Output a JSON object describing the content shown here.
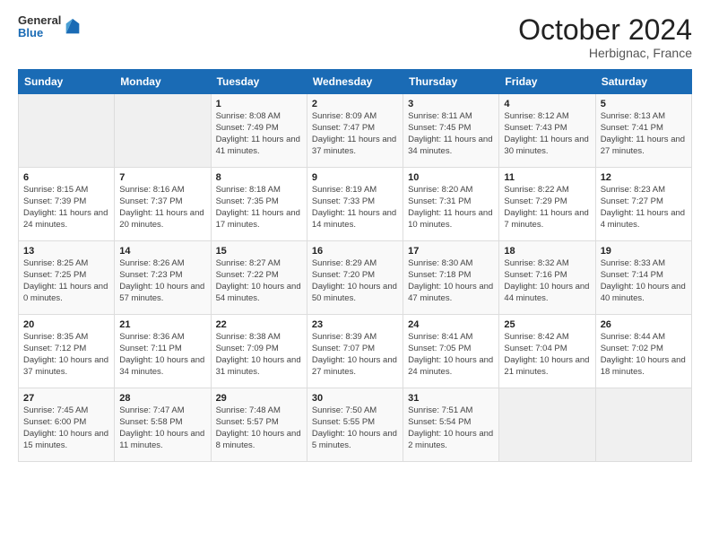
{
  "logo": {
    "general": "General",
    "blue": "Blue"
  },
  "title": "October 2024",
  "location": "Herbignac, France",
  "days_of_week": [
    "Sunday",
    "Monday",
    "Tuesday",
    "Wednesday",
    "Thursday",
    "Friday",
    "Saturday"
  ],
  "weeks": [
    [
      {
        "day": "",
        "sunrise": "",
        "sunset": "",
        "daylight": ""
      },
      {
        "day": "",
        "sunrise": "",
        "sunset": "",
        "daylight": ""
      },
      {
        "day": "1",
        "sunrise": "Sunrise: 8:08 AM",
        "sunset": "Sunset: 7:49 PM",
        "daylight": "Daylight: 11 hours and 41 minutes."
      },
      {
        "day": "2",
        "sunrise": "Sunrise: 8:09 AM",
        "sunset": "Sunset: 7:47 PM",
        "daylight": "Daylight: 11 hours and 37 minutes."
      },
      {
        "day": "3",
        "sunrise": "Sunrise: 8:11 AM",
        "sunset": "Sunset: 7:45 PM",
        "daylight": "Daylight: 11 hours and 34 minutes."
      },
      {
        "day": "4",
        "sunrise": "Sunrise: 8:12 AM",
        "sunset": "Sunset: 7:43 PM",
        "daylight": "Daylight: 11 hours and 30 minutes."
      },
      {
        "day": "5",
        "sunrise": "Sunrise: 8:13 AM",
        "sunset": "Sunset: 7:41 PM",
        "daylight": "Daylight: 11 hours and 27 minutes."
      }
    ],
    [
      {
        "day": "6",
        "sunrise": "Sunrise: 8:15 AM",
        "sunset": "Sunset: 7:39 PM",
        "daylight": "Daylight: 11 hours and 24 minutes."
      },
      {
        "day": "7",
        "sunrise": "Sunrise: 8:16 AM",
        "sunset": "Sunset: 7:37 PM",
        "daylight": "Daylight: 11 hours and 20 minutes."
      },
      {
        "day": "8",
        "sunrise": "Sunrise: 8:18 AM",
        "sunset": "Sunset: 7:35 PM",
        "daylight": "Daylight: 11 hours and 17 minutes."
      },
      {
        "day": "9",
        "sunrise": "Sunrise: 8:19 AM",
        "sunset": "Sunset: 7:33 PM",
        "daylight": "Daylight: 11 hours and 14 minutes."
      },
      {
        "day": "10",
        "sunrise": "Sunrise: 8:20 AM",
        "sunset": "Sunset: 7:31 PM",
        "daylight": "Daylight: 11 hours and 10 minutes."
      },
      {
        "day": "11",
        "sunrise": "Sunrise: 8:22 AM",
        "sunset": "Sunset: 7:29 PM",
        "daylight": "Daylight: 11 hours and 7 minutes."
      },
      {
        "day": "12",
        "sunrise": "Sunrise: 8:23 AM",
        "sunset": "Sunset: 7:27 PM",
        "daylight": "Daylight: 11 hours and 4 minutes."
      }
    ],
    [
      {
        "day": "13",
        "sunrise": "Sunrise: 8:25 AM",
        "sunset": "Sunset: 7:25 PM",
        "daylight": "Daylight: 11 hours and 0 minutes."
      },
      {
        "day": "14",
        "sunrise": "Sunrise: 8:26 AM",
        "sunset": "Sunset: 7:23 PM",
        "daylight": "Daylight: 10 hours and 57 minutes."
      },
      {
        "day": "15",
        "sunrise": "Sunrise: 8:27 AM",
        "sunset": "Sunset: 7:22 PM",
        "daylight": "Daylight: 10 hours and 54 minutes."
      },
      {
        "day": "16",
        "sunrise": "Sunrise: 8:29 AM",
        "sunset": "Sunset: 7:20 PM",
        "daylight": "Daylight: 10 hours and 50 minutes."
      },
      {
        "day": "17",
        "sunrise": "Sunrise: 8:30 AM",
        "sunset": "Sunset: 7:18 PM",
        "daylight": "Daylight: 10 hours and 47 minutes."
      },
      {
        "day": "18",
        "sunrise": "Sunrise: 8:32 AM",
        "sunset": "Sunset: 7:16 PM",
        "daylight": "Daylight: 10 hours and 44 minutes."
      },
      {
        "day": "19",
        "sunrise": "Sunrise: 8:33 AM",
        "sunset": "Sunset: 7:14 PM",
        "daylight": "Daylight: 10 hours and 40 minutes."
      }
    ],
    [
      {
        "day": "20",
        "sunrise": "Sunrise: 8:35 AM",
        "sunset": "Sunset: 7:12 PM",
        "daylight": "Daylight: 10 hours and 37 minutes."
      },
      {
        "day": "21",
        "sunrise": "Sunrise: 8:36 AM",
        "sunset": "Sunset: 7:11 PM",
        "daylight": "Daylight: 10 hours and 34 minutes."
      },
      {
        "day": "22",
        "sunrise": "Sunrise: 8:38 AM",
        "sunset": "Sunset: 7:09 PM",
        "daylight": "Daylight: 10 hours and 31 minutes."
      },
      {
        "day": "23",
        "sunrise": "Sunrise: 8:39 AM",
        "sunset": "Sunset: 7:07 PM",
        "daylight": "Daylight: 10 hours and 27 minutes."
      },
      {
        "day": "24",
        "sunrise": "Sunrise: 8:41 AM",
        "sunset": "Sunset: 7:05 PM",
        "daylight": "Daylight: 10 hours and 24 minutes."
      },
      {
        "day": "25",
        "sunrise": "Sunrise: 8:42 AM",
        "sunset": "Sunset: 7:04 PM",
        "daylight": "Daylight: 10 hours and 21 minutes."
      },
      {
        "day": "26",
        "sunrise": "Sunrise: 8:44 AM",
        "sunset": "Sunset: 7:02 PM",
        "daylight": "Daylight: 10 hours and 18 minutes."
      }
    ],
    [
      {
        "day": "27",
        "sunrise": "Sunrise: 7:45 AM",
        "sunset": "Sunset: 6:00 PM",
        "daylight": "Daylight: 10 hours and 15 minutes."
      },
      {
        "day": "28",
        "sunrise": "Sunrise: 7:47 AM",
        "sunset": "Sunset: 5:58 PM",
        "daylight": "Daylight: 10 hours and 11 minutes."
      },
      {
        "day": "29",
        "sunrise": "Sunrise: 7:48 AM",
        "sunset": "Sunset: 5:57 PM",
        "daylight": "Daylight: 10 hours and 8 minutes."
      },
      {
        "day": "30",
        "sunrise": "Sunrise: 7:50 AM",
        "sunset": "Sunset: 5:55 PM",
        "daylight": "Daylight: 10 hours and 5 minutes."
      },
      {
        "day": "31",
        "sunrise": "Sunrise: 7:51 AM",
        "sunset": "Sunset: 5:54 PM",
        "daylight": "Daylight: 10 hours and 2 minutes."
      },
      {
        "day": "",
        "sunrise": "",
        "sunset": "",
        "daylight": ""
      },
      {
        "day": "",
        "sunrise": "",
        "sunset": "",
        "daylight": ""
      }
    ]
  ]
}
